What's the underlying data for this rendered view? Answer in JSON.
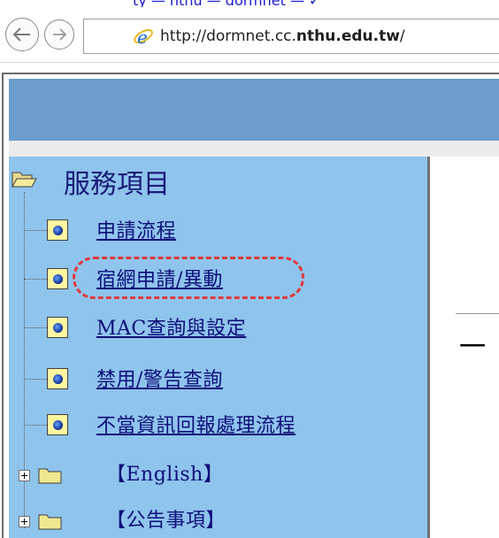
{
  "browser": {
    "top_strip_text": "ty — nthu — dormnet — ✓",
    "url_prefix": "http://dormnet.cc.",
    "url_bold": "nthu.edu.tw",
    "url_suffix": "/"
  },
  "sidebar": {
    "heading": "服務項目",
    "items": [
      {
        "label": "申請流程"
      },
      {
        "label": "宿網申請/異動"
      },
      {
        "label": "MAC查詢與設定"
      },
      {
        "label": "禁用/警告查詢"
      },
      {
        "label": "不當資訊回報處理流程"
      }
    ],
    "folders": [
      {
        "label": "【English】"
      },
      {
        "label": "【公告事項】"
      }
    ]
  },
  "main": {
    "glyph": "一"
  },
  "colors": {
    "header_band": "#6c9ccc",
    "sidebar_bg": "#8fc4ed",
    "highlight": "#e03a3a"
  }
}
